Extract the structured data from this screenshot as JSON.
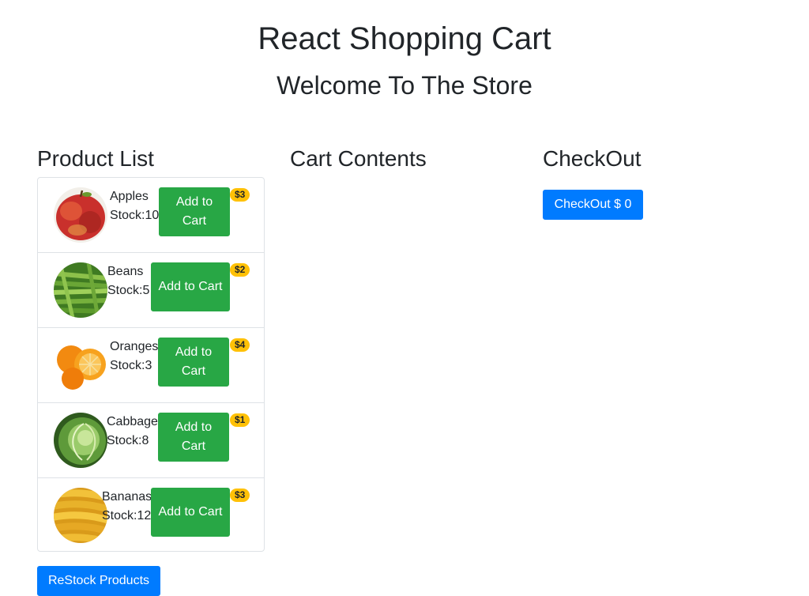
{
  "header": {
    "title": "React Shopping Cart",
    "subtitle": "Welcome To The Store"
  },
  "columns": {
    "products_heading": "Product List",
    "cart_heading": "Cart Contents",
    "checkout_heading": "CheckOut"
  },
  "products": [
    {
      "name": "Apples",
      "stock": "Stock:10",
      "price": "$3",
      "button": "Add to Cart",
      "icon": "apple-image"
    },
    {
      "name": "Beans",
      "stock": "Stock:5",
      "price": "$2",
      "button": "Add to Cart",
      "icon": "beans-image"
    },
    {
      "name": "Oranges",
      "stock": "Stock:3",
      "price": "$4",
      "button": "Add to Cart",
      "icon": "oranges-image"
    },
    {
      "name": "Cabbage",
      "stock": "Stock:8",
      "price": "$1",
      "button": "Add to Cart",
      "icon": "cabbage-image"
    },
    {
      "name": "Bananas",
      "stock": "Stock:12",
      "price": "$3",
      "button": "Add to Cart",
      "icon": "bananas-image"
    }
  ],
  "checkout": {
    "button_label": "CheckOut $ 0"
  },
  "restock": {
    "button_label": "ReStock Products"
  },
  "colors": {
    "add_button": "#28a745",
    "primary_button": "#007bff",
    "price_badge": "#ffc107",
    "border": "#dee2e6"
  }
}
